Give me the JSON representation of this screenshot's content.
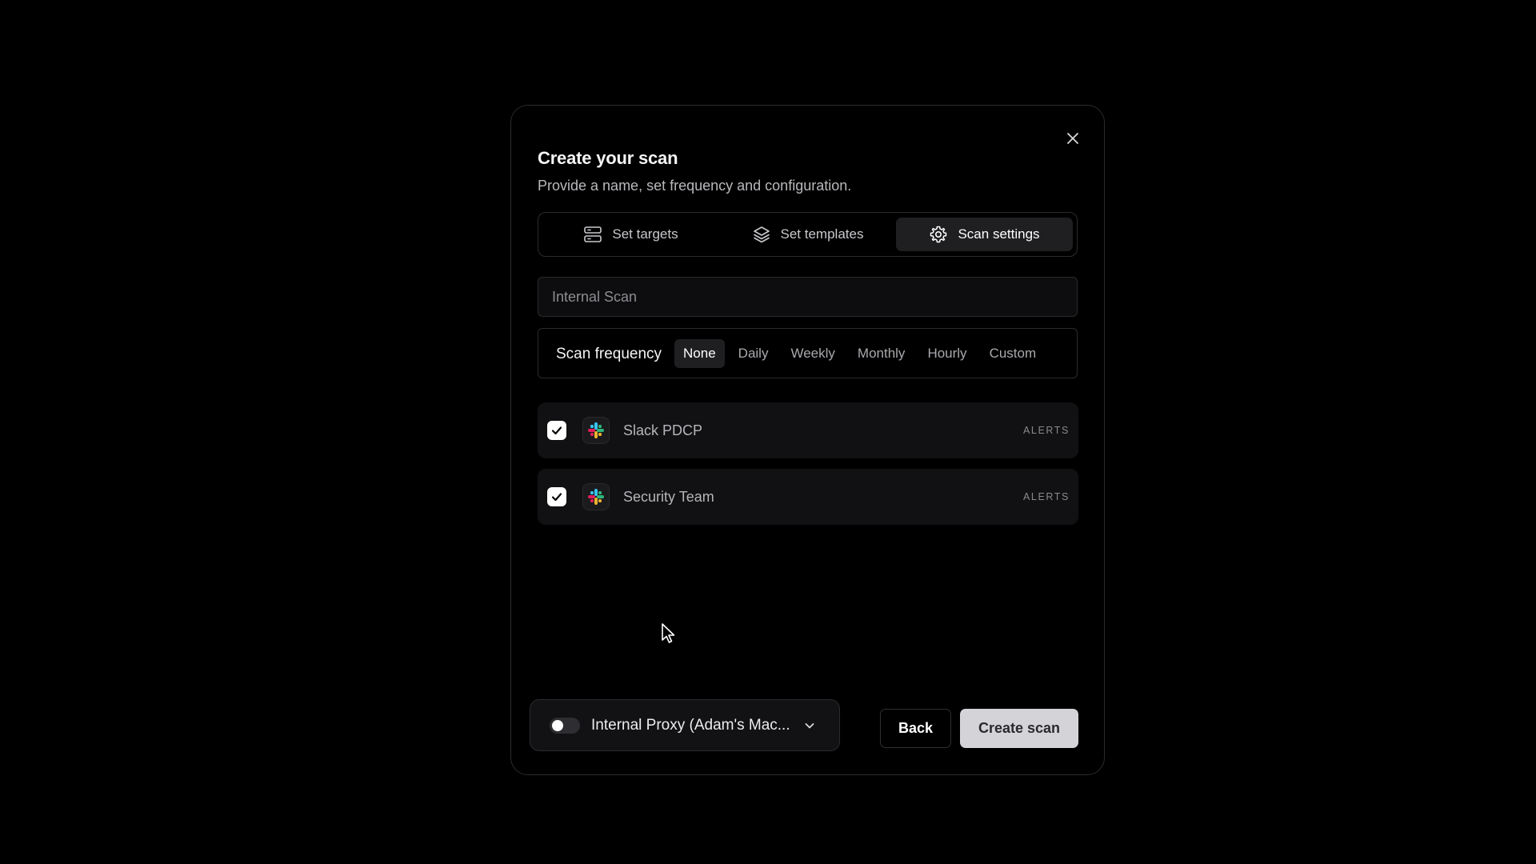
{
  "modal": {
    "title": "Create your scan",
    "subtitle": "Provide a name, set frequency and configuration."
  },
  "tabs": [
    {
      "label": "Set targets",
      "icon": "server-icon",
      "active": false
    },
    {
      "label": "Set templates",
      "icon": "layers-icon",
      "active": false
    },
    {
      "label": "Scan settings",
      "icon": "gear-icon",
      "active": true
    }
  ],
  "name_input": {
    "value": "Internal Scan",
    "placeholder": ""
  },
  "frequency": {
    "label": "Scan frequency",
    "options": [
      "None",
      "Daily",
      "Weekly",
      "Monthly",
      "Hourly",
      "Custom"
    ],
    "selected": "None"
  },
  "integrations": [
    {
      "name": "Slack PDCP",
      "badge": "ALERTS",
      "checked": true,
      "icon": "slack-icon"
    },
    {
      "name": "Security Team",
      "badge": "ALERTS",
      "checked": true,
      "icon": "slack-icon"
    }
  ],
  "proxy": {
    "label": "Internal Proxy (Adam's Mac...",
    "enabled": false
  },
  "actions": {
    "back_label": "Back",
    "create_label": "Create scan"
  },
  "colors": {
    "background": "#000000",
    "surface": "#111113",
    "border": "#2b2b2e",
    "primary_button": "#d4d4d8",
    "slack_blue": "#36C5F0",
    "slack_green": "#2EB67D",
    "slack_red": "#E01E5A",
    "slack_yellow": "#ECB22E"
  }
}
